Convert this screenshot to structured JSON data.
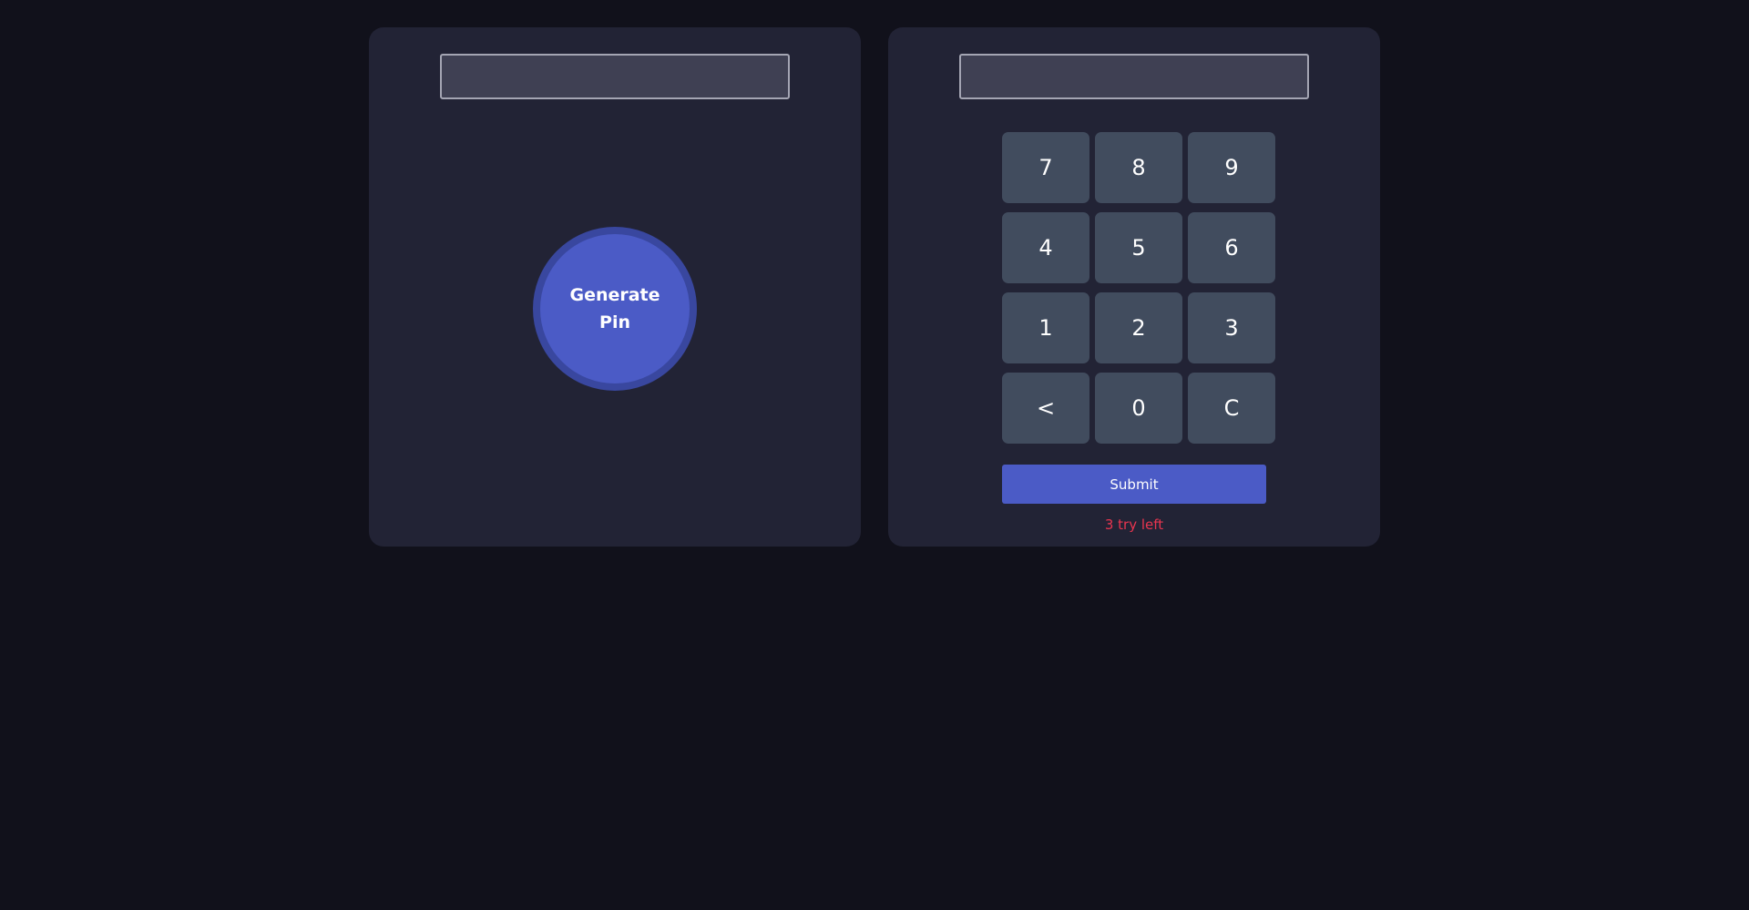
{
  "generator": {
    "display_value": "",
    "button_label": "Generate Pin"
  },
  "entry": {
    "display_value": "",
    "keys": [
      "7",
      "8",
      "9",
      "4",
      "5",
      "6",
      "1",
      "2",
      "3",
      "<",
      "0",
      "C"
    ],
    "submit_label": "Submit",
    "tries_text": "3 try left"
  },
  "colors": {
    "background": "#11111b",
    "panel": "#222335",
    "accent": "#4b5bc6",
    "key": "#414c5e",
    "warning": "#e8354f"
  }
}
